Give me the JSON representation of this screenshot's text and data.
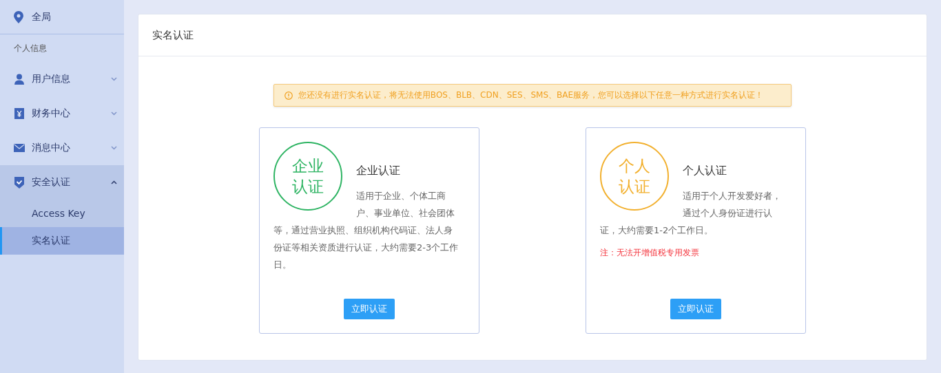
{
  "sidebar": {
    "top": {
      "label": "全局"
    },
    "section_label": "个人信息",
    "items": [
      {
        "label": "用户信息",
        "expanded": false
      },
      {
        "label": "财务中心",
        "expanded": false
      },
      {
        "label": "消息中心",
        "expanded": false
      },
      {
        "label": "安全认证",
        "expanded": true,
        "children": [
          {
            "label": "Access Key",
            "selected": false
          },
          {
            "label": "实名认证",
            "selected": true
          }
        ]
      }
    ]
  },
  "panel": {
    "title": "实名认证",
    "alert": "您还没有进行实名认证，将无法使用BOS、BLB、CDN、SES、SMS、BAE服务，您可以选择以下任意一种方式进行实名认证！",
    "cards": [
      {
        "badge": [
          "企业",
          "认证"
        ],
        "color": "#2eb463",
        "title": "企业认证",
        "description": "适用于企业、个体工商户、事业单位、社会团体等，通过营业执照、组织机构代码证、法人身份证等相关资质进行认证，大约需要2-3个工作日。",
        "button": "立即认证"
      },
      {
        "badge": [
          "个人",
          "认证"
        ],
        "color": "#f2b02e",
        "title": "个人认证",
        "description": "适用于个人开发爱好者，通过个人身份证进行认证，大约需要1-2个工作日。",
        "note": "注：无法开增值税专用发票",
        "button": "立即认证"
      }
    ]
  }
}
